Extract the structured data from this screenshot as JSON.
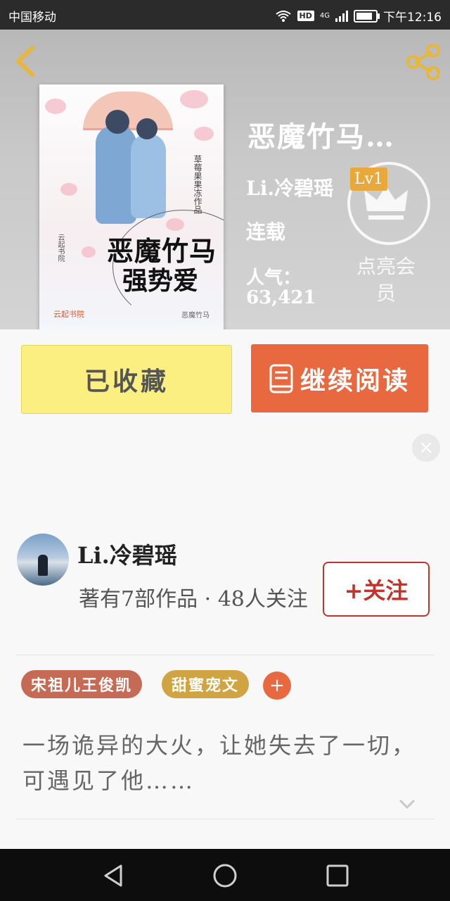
{
  "status_bar": {
    "carrier": "中国移动",
    "network": "4G",
    "hd_label": "HD",
    "time": "下午12:16",
    "battery_level": 0.85
  },
  "book": {
    "title": "恶魔竹马…",
    "author": "Li.冷碧瑶",
    "author_level": "Lv1",
    "status": "连载",
    "popularity_label": "人气：",
    "popularity_value": "63,421",
    "vip_text": "点亮会员",
    "cover": {
      "title_line1": "恶魔竹马",
      "title_line2": "强势爱",
      "author": "草莓果果冻",
      "author_suffix": "作品",
      "publisher": "云起书院",
      "brand": "云起书院",
      "footer": "恶魔竹马"
    }
  },
  "actions": {
    "collected_label": "已收藏",
    "read_label": "继续阅读",
    "close_label": "×"
  },
  "author_card": {
    "name": "Li.冷碧瑶",
    "meta": "著有7部作品 · 48人关注",
    "follow_label": "+关注"
  },
  "tags": [
    "宋祖儿王俊凯",
    "甜蜜宠文"
  ],
  "tag_add_label": "+",
  "synopsis": "一场诡异的大火，让她失去了一切，可遇见了他……",
  "colors": {
    "accent_orange": "#e8683f",
    "collected_yellow": "#fbef81",
    "follow_red": "#c2332b",
    "tag_red": "#c46a55",
    "tag_gold": "#d1a443",
    "level_badge": "#e8a93a"
  },
  "icons": {
    "back": "chevron-left-icon",
    "share": "share-icon",
    "vip": "crown-icon",
    "read": "book-icon",
    "nav_back": "triangle-back-icon",
    "nav_home": "circle-home-icon",
    "nav_recent": "square-recent-icon"
  }
}
